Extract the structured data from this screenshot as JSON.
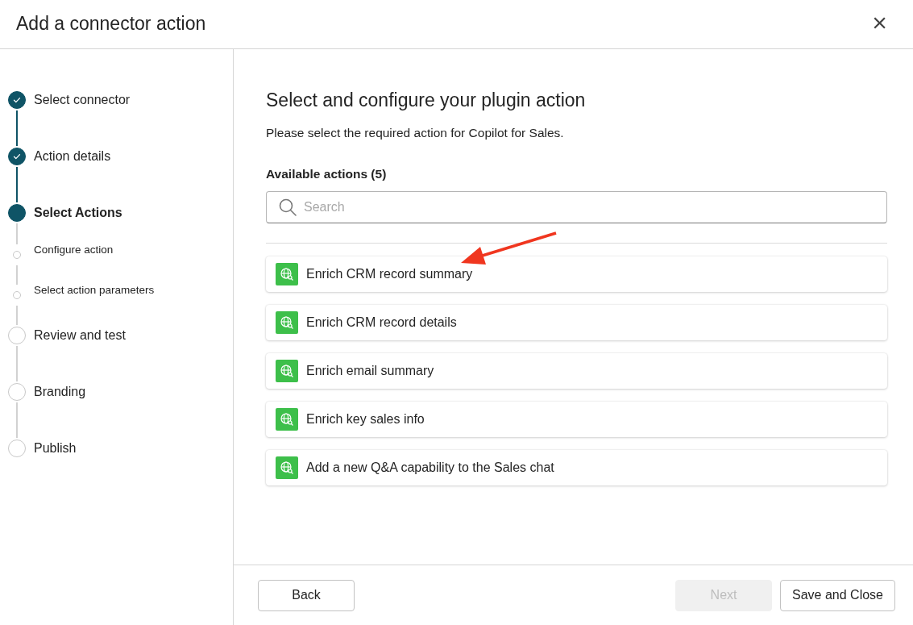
{
  "dialog": {
    "title": "Add a connector action",
    "close_glyph": "×"
  },
  "steps": [
    {
      "label": "Select connector",
      "kind": "step",
      "completed": true,
      "selected": false
    },
    {
      "label": "Action details",
      "kind": "step",
      "completed": true,
      "selected": false
    },
    {
      "label": "Select Actions",
      "kind": "step",
      "completed": false,
      "selected": true
    },
    {
      "label": "Configure action",
      "kind": "substep",
      "completed": false,
      "selected": false
    },
    {
      "label": "Select action parameters",
      "kind": "substep",
      "completed": false,
      "selected": false
    },
    {
      "label": "Review and test",
      "kind": "step",
      "completed": false,
      "selected": false
    },
    {
      "label": "Branding",
      "kind": "step",
      "completed": false,
      "selected": false
    },
    {
      "label": "Publish",
      "kind": "step",
      "completed": false,
      "selected": false
    }
  ],
  "main": {
    "heading": "Select and configure your plugin action",
    "description": "Please select the required action for Copilot for Sales.",
    "list_label": "Available actions (5)",
    "search": {
      "placeholder": "Search"
    },
    "actions": [
      {
        "label": "Enrich CRM record summary"
      },
      {
        "label": "Enrich CRM record details"
      },
      {
        "label": "Enrich email summary"
      },
      {
        "label": "Enrich key sales info"
      },
      {
        "label": "Add a new Q&A capability to the Sales chat"
      }
    ]
  },
  "footer": {
    "buttons": [
      {
        "label": "Back",
        "disabled": false
      },
      {
        "label": "Next",
        "disabled": true
      },
      {
        "label": "Save and Close",
        "disabled": false
      }
    ]
  }
}
